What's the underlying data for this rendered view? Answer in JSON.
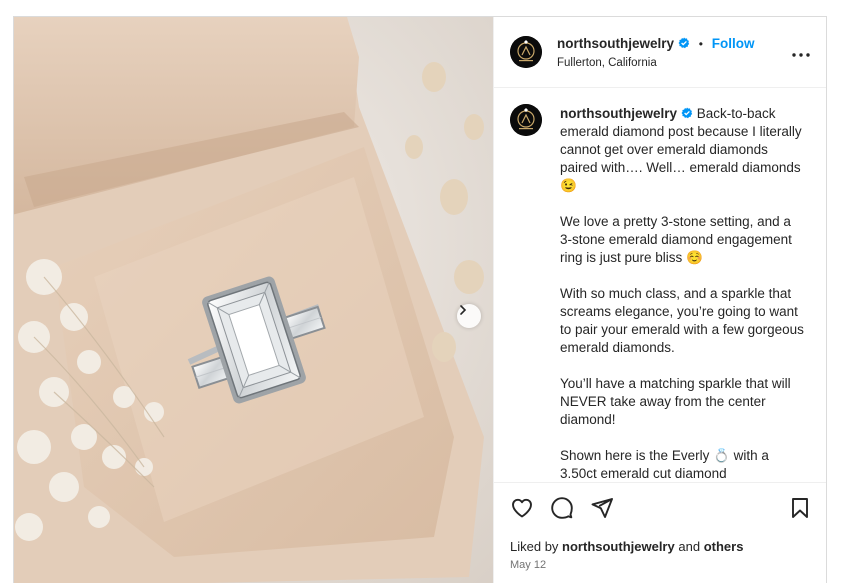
{
  "post": {
    "username": "northsouthjewelry",
    "follow_label": "Follow",
    "separator": "•",
    "location": "Fullerton, California",
    "caption": {
      "p1": "Back-to-back emerald diamond post because I literally cannot get over emerald diamonds paired with…. Well… emerald diamonds",
      "p1_emoji": "😉",
      "p2": "We love a pretty 3-stone setting, and a 3-stone emerald diamond engagement ring is just pure bliss",
      "p2_emoji": "☺️",
      "p3": "With so much class, and a sparkle that screams elegance, you’re going to want to pair your emerald with a few gorgeous emerald diamonds.",
      "p4": "You’ll have a matching sparkle that will NEVER take away from the center diamond!",
      "p5_a": "Shown here is the Everly",
      "p5_emoji": "💍",
      "p5_b": "with a 3.50ct emerald cut diamond"
    },
    "liked_by_prefix": "Liked by",
    "liked_by_user": "northsouthjewelry",
    "liked_by_and": "and",
    "liked_by_others": "others",
    "date": "May 12"
  },
  "icons": {
    "like": "heart-icon",
    "comment": "comment-icon",
    "share": "share-icon",
    "save": "bookmark-icon",
    "more": "more-options-icon",
    "next": "chevron-right-icon",
    "verified": "verified-badge-icon"
  },
  "colors": {
    "link_blue": "#0095f6",
    "text": "#262626",
    "muted": "#737373",
    "border": "#dbdbdb"
  }
}
